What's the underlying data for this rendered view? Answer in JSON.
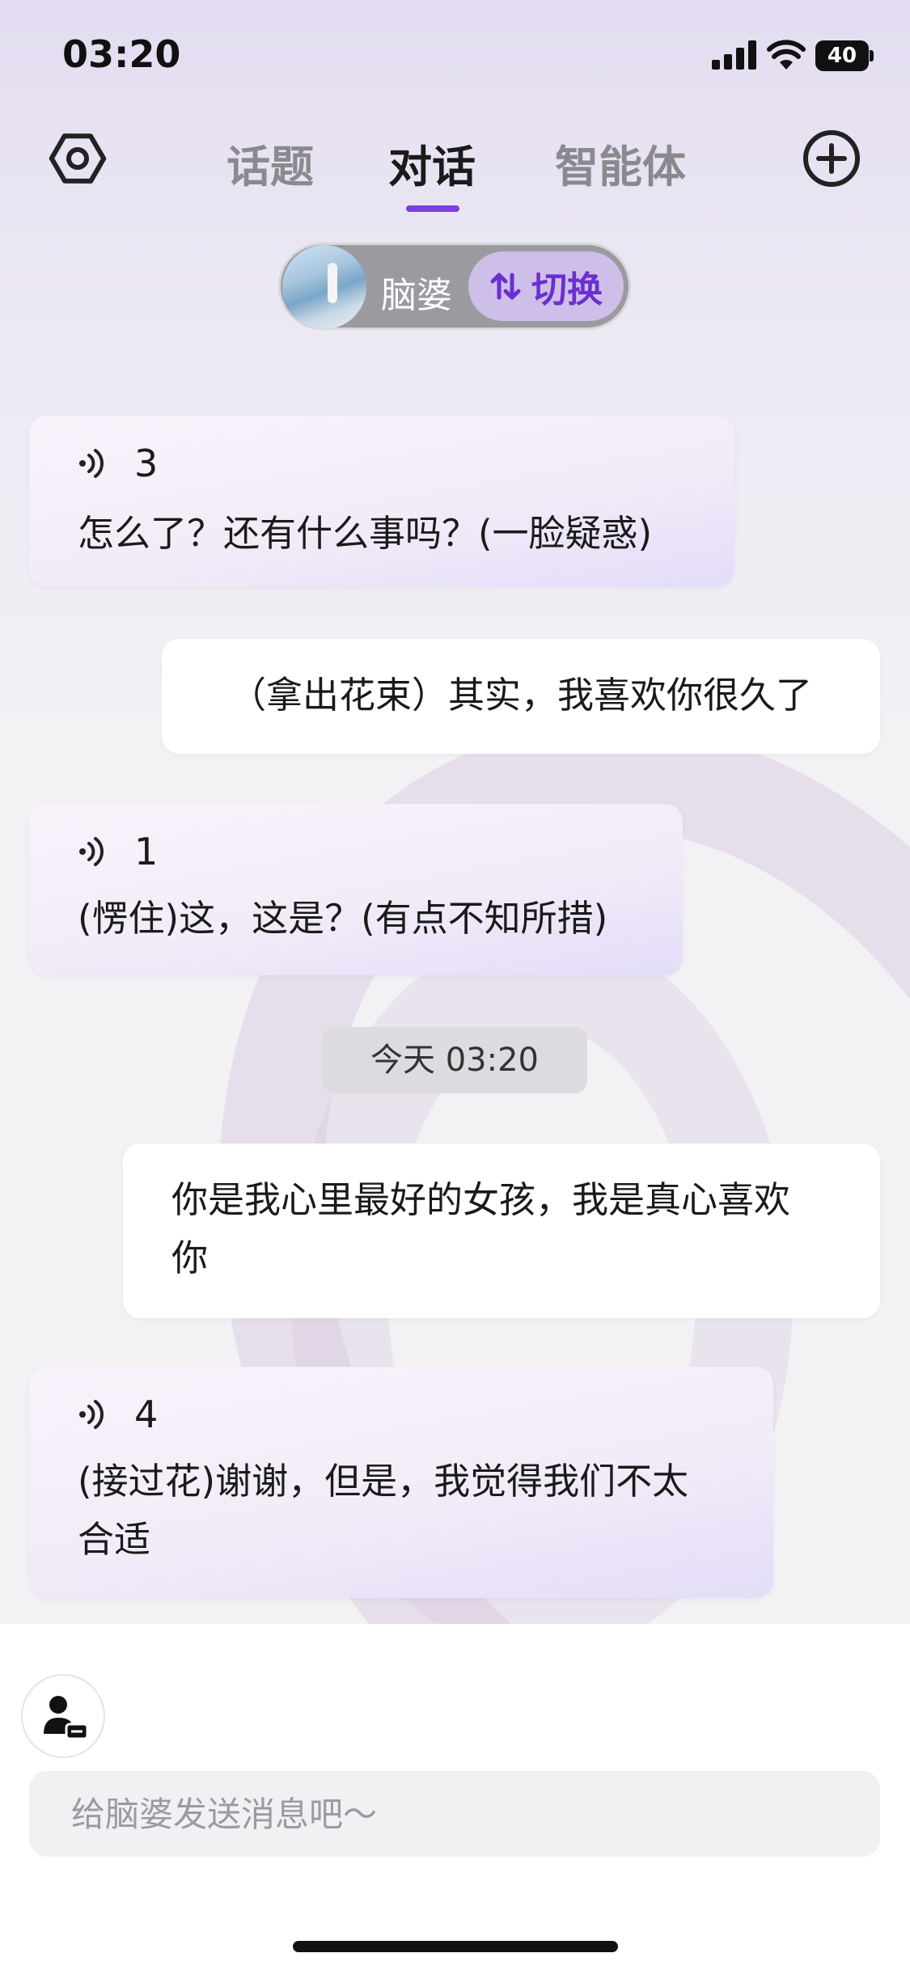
{
  "status_bar": {
    "time": "03:20",
    "battery": "40"
  },
  "nav": {
    "tabs": [
      {
        "label": "话题"
      },
      {
        "label": "对话"
      },
      {
        "label": "智能体"
      }
    ],
    "active_tab": "对话"
  },
  "character": {
    "name": "脑婆",
    "switch_label": "切换"
  },
  "messages": [
    {
      "role": "bot",
      "audio_count": "3",
      "text_lines": [
        "怎么了？还有什么事吗？(一脸疑惑)"
      ]
    },
    {
      "role": "user",
      "text_lines": [
        "（拿出花束）其实，我喜欢你很久了"
      ]
    },
    {
      "role": "bot",
      "audio_count": "1",
      "text_lines": [
        "(愣住)这，这是？(有点不知所措)"
      ]
    },
    {
      "role": "user",
      "text_lines": [
        "你是我心里最好的女孩，我是真心喜欢",
        "你"
      ]
    },
    {
      "role": "bot",
      "audio_count": "4",
      "text_lines": [
        "(接过花)谢谢，但是，我觉得我们不太",
        "合适"
      ]
    }
  ],
  "timestamp": "今天 03:20",
  "input": {
    "placeholder": "给脑婆发送消息吧～",
    "value": ""
  },
  "colors": {
    "accent": "#7a3fe0",
    "switch_text": "#6b2fd0"
  }
}
